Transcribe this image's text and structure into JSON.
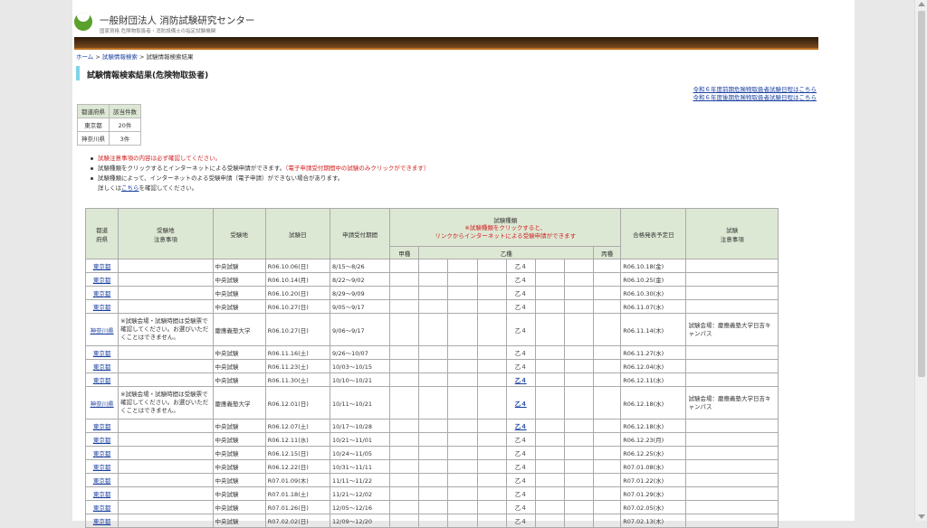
{
  "header": {
    "site_title": "一般財団法人 消防試験研究センター",
    "site_subtitle": "国家資格 危険物取扱者・消防設備士の指定試験機関"
  },
  "breadcrumb": [
    "ホーム",
    "試験情報検索",
    "試験情報検索結果"
  ],
  "page_title": "試験情報検索結果(危険物取扱者)",
  "top_links": [
    "令和６年度前期危険物取扱者試験日程はこちら",
    "令和６年度後期危険物取扱者試験日程はこちら"
  ],
  "summary": {
    "headers": [
      "都道府県",
      "該当件数"
    ],
    "rows": [
      {
        "pref": "東京都",
        "count": "20件"
      },
      {
        "pref": "神奈川県",
        "count": "3件"
      }
    ]
  },
  "notes": {
    "n1": "試験注意事項の内容は必ず確認してください。",
    "n2": "試験種類をクリックするとインターネットによる受験申請ができます。",
    "n2_red": "（電子申請受付期間中の試験のみクリックができます）",
    "n3": "試験種類によって、インターネットのよる受験申請（電子申請）ができない場合があります。",
    "n4_pre": "詳しくは",
    "n4_link": "こちら",
    "n4_post": "を確認してください。"
  },
  "table": {
    "h_pref": "都道\n府県",
    "h_venue_note": "受験地\n注意事項",
    "h_venue": "受験地",
    "h_date": "試験日",
    "h_period": "申請受付期間",
    "h_type_title": "試験種類",
    "h_type_red": "※試験種類をクリックすると、\nリンクからインターネットによる受験申請ができます",
    "h_kou": "甲種",
    "h_otsu": "乙種",
    "h_hei": "丙種",
    "h_result": "合格発表予定日",
    "h_note": "試験\n注意事項",
    "rows": [
      {
        "pref": "東京都",
        "vnote": "",
        "venue": "中央試験",
        "date": "R06.10.06(日)",
        "period": "8/15～8/26",
        "otsu": "乙４",
        "link": false,
        "result": "R06.10.18(金)",
        "note": ""
      },
      {
        "pref": "東京都",
        "vnote": "",
        "venue": "中央試験",
        "date": "R06.10.14(月)",
        "period": "8/22～9/02",
        "otsu": "乙４",
        "link": false,
        "result": "R06.10.25(金)",
        "note": ""
      },
      {
        "pref": "東京都",
        "vnote": "",
        "venue": "中央試験",
        "date": "R06.10.20(日)",
        "period": "8/29～9/09",
        "otsu": "乙４",
        "link": false,
        "result": "R06.10.30(水)",
        "note": ""
      },
      {
        "pref": "東京都",
        "vnote": "",
        "venue": "中央試験",
        "date": "R06.10.27(日)",
        "period": "9/05～9/17",
        "otsu": "乙４",
        "link": false,
        "result": "R06.11.07(水)",
        "note": ""
      },
      {
        "pref": "神奈川県",
        "vnote": "※試験会場・試験時間は受験票で確認してください。お選びいただくことはできません。",
        "venue": "慶應義塾大学",
        "date": "R06.10.27(日)",
        "period": "9/06～9/17",
        "otsu": "乙４",
        "link": false,
        "result": "R06.11.14(木)",
        "note": "試験会場：慶應義塾大学日吉キャンパス"
      },
      {
        "pref": "東京都",
        "vnote": "",
        "venue": "中央試験",
        "date": "R06.11.16(土)",
        "period": "9/26～10/07",
        "otsu": "乙４",
        "link": false,
        "result": "R06.11.27(水)",
        "note": ""
      },
      {
        "pref": "東京都",
        "vnote": "",
        "venue": "中央試験",
        "date": "R06.11.23(土)",
        "period": "10/03～10/15",
        "otsu": "乙４",
        "link": false,
        "result": "R06.12.04(水)",
        "note": ""
      },
      {
        "pref": "東京都",
        "vnote": "",
        "venue": "中央試験",
        "date": "R06.11.30(土)",
        "period": "10/10～10/21",
        "otsu": "乙４",
        "link": true,
        "result": "R06.12.11(水)",
        "note": ""
      },
      {
        "pref": "神奈川県",
        "vnote": "※試験会場・試験時間は受験票で確認してください。お選びいただくことはできません。",
        "venue": "慶應義塾大学",
        "date": "R06.12.01(日)",
        "period": "10/11～10/21",
        "otsu": "乙４",
        "link": true,
        "result": "R06.12.18(水)",
        "note": "試験会場：慶應義塾大学日吉キャンパス"
      },
      {
        "pref": "東京都",
        "vnote": "",
        "venue": "中央試験",
        "date": "R06.12.07(土)",
        "period": "10/17～10/28",
        "otsu": "乙４",
        "link": true,
        "result": "R06.12.18(水)",
        "note": ""
      },
      {
        "pref": "東京都",
        "vnote": "",
        "venue": "中央試験",
        "date": "R06.12.11(水)",
        "period": "10/21～11/01",
        "otsu": "乙４",
        "link": false,
        "result": "R06.12.23(月)",
        "note": ""
      },
      {
        "pref": "東京都",
        "vnote": "",
        "venue": "中央試験",
        "date": "R06.12.15(日)",
        "period": "10/24～11/05",
        "otsu": "乙４",
        "link": false,
        "result": "R06.12.25(水)",
        "note": ""
      },
      {
        "pref": "東京都",
        "vnote": "",
        "venue": "中央試験",
        "date": "R06.12.22(日)",
        "period": "10/31～11/11",
        "otsu": "乙４",
        "link": false,
        "result": "R07.01.08(水)",
        "note": ""
      },
      {
        "pref": "東京都",
        "vnote": "",
        "venue": "中央試験",
        "date": "R07.01.09(木)",
        "period": "11/11～11/22",
        "otsu": "乙４",
        "link": false,
        "result": "R07.01.22(水)",
        "note": ""
      },
      {
        "pref": "東京都",
        "vnote": "",
        "venue": "中央試験",
        "date": "R07.01.18(土)",
        "period": "11/21～12/02",
        "otsu": "乙４",
        "link": false,
        "result": "R07.01.29(水)",
        "note": ""
      },
      {
        "pref": "東京都",
        "vnote": "",
        "venue": "中央試験",
        "date": "R07.01.26(日)",
        "period": "12/05～12/16",
        "otsu": "乙４",
        "link": false,
        "result": "R07.02.05(水)",
        "note": ""
      },
      {
        "pref": "東京都",
        "vnote": "",
        "venue": "中央試験",
        "date": "R07.02.02(日)",
        "period": "12/09～12/20",
        "otsu": "乙４",
        "link": false,
        "result": "R07.02.13(木)",
        "note": ""
      }
    ]
  }
}
